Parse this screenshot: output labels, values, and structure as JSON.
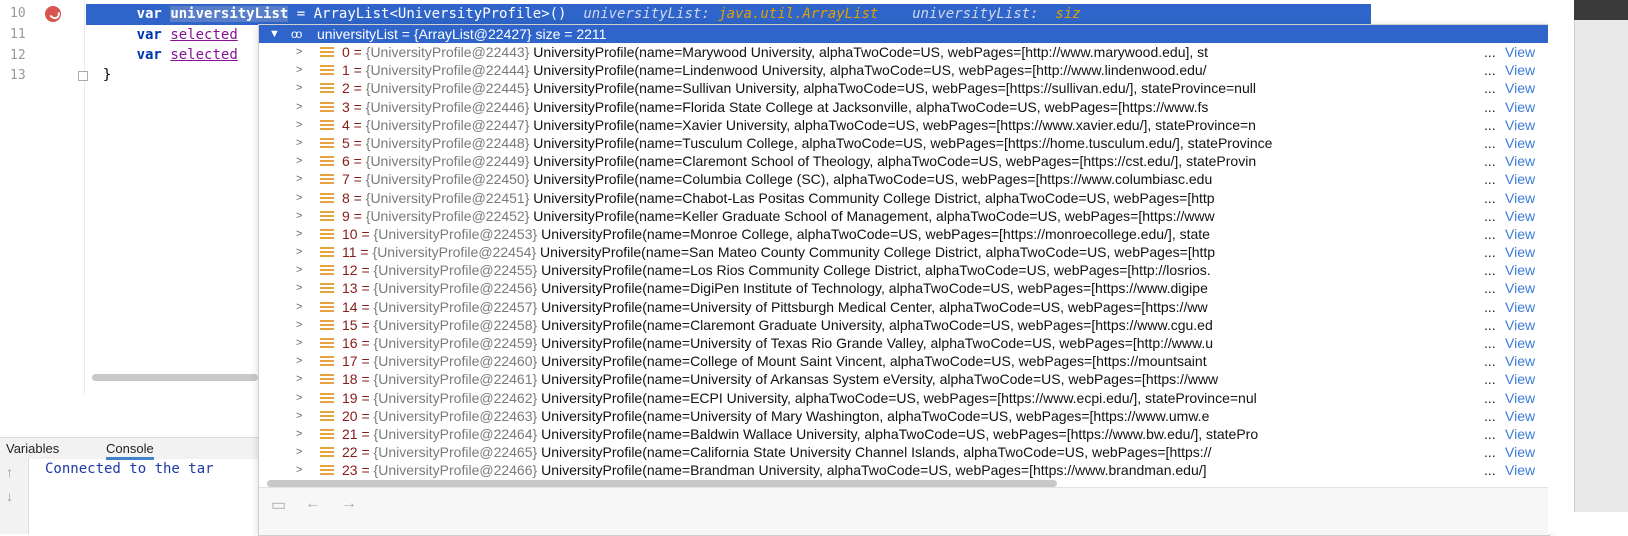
{
  "editor": {
    "line_numbers": [
      "10",
      "11",
      "12",
      "13"
    ],
    "line1": {
      "kw": "var",
      "name": "universityList",
      "rest": " = ArrayList<UniversityProfile>()",
      "hint1_label": "universityList:",
      "hint1_type": "java.util.ArrayList",
      "hint2_label": "universityList:",
      "hint2_type": "siz"
    },
    "line2": {
      "kw": "var",
      "ident": "selected"
    },
    "line3": {
      "kw": "var",
      "ident": "selected"
    },
    "line4": {
      "text": "}"
    }
  },
  "tool_window": {
    "tabs": [
      "Variables",
      "Console"
    ],
    "active_tab": "Console",
    "console_text": "Connected to the tar"
  },
  "popup": {
    "header": "universityList = {ArrayList@22427}  size = 2211",
    "view_label": "View",
    "ellipsis": "...",
    "rows": [
      {
        "idx": "0",
        "ref": "{UniversityProfile@22443}",
        "value": "UniversityProfile(name=Marywood University, alphaTwoCode=US, webPages=[http://www.marywood.edu], st"
      },
      {
        "idx": "1",
        "ref": "{UniversityProfile@22444}",
        "value": "UniversityProfile(name=Lindenwood University, alphaTwoCode=US, webPages=[http://www.lindenwood.edu/"
      },
      {
        "idx": "2",
        "ref": "{UniversityProfile@22445}",
        "value": "UniversityProfile(name=Sullivan University, alphaTwoCode=US, webPages=[https://sullivan.edu/], stateProvince=null"
      },
      {
        "idx": "3",
        "ref": "{UniversityProfile@22446}",
        "value": "UniversityProfile(name=Florida State College at Jacksonville, alphaTwoCode=US, webPages=[https://www.fs"
      },
      {
        "idx": "4",
        "ref": "{UniversityProfile@22447}",
        "value": "UniversityProfile(name=Xavier University, alphaTwoCode=US, webPages=[https://www.xavier.edu/], stateProvince=n"
      },
      {
        "idx": "5",
        "ref": "{UniversityProfile@22448}",
        "value": "UniversityProfile(name=Tusculum College, alphaTwoCode=US, webPages=[https://home.tusculum.edu/], stateProvince"
      },
      {
        "idx": "6",
        "ref": "{UniversityProfile@22449}",
        "value": "UniversityProfile(name=Claremont School of Theology, alphaTwoCode=US, webPages=[https://cst.edu/], stateProvin"
      },
      {
        "idx": "7",
        "ref": "{UniversityProfile@22450}",
        "value": "UniversityProfile(name=Columbia College (SC), alphaTwoCode=US, webPages=[https://www.columbiasc.edu"
      },
      {
        "idx": "8",
        "ref": "{UniversityProfile@22451}",
        "value": "UniversityProfile(name=Chabot-Las Positas Community College District, alphaTwoCode=US, webPages=[http"
      },
      {
        "idx": "9",
        "ref": "{UniversityProfile@22452}",
        "value": "UniversityProfile(name=Keller Graduate School of Management, alphaTwoCode=US, webPages=[https://www"
      },
      {
        "idx": "10",
        "ref": "{UniversityProfile@22453}",
        "value": "UniversityProfile(name=Monroe College, alphaTwoCode=US, webPages=[https://monroecollege.edu/], state"
      },
      {
        "idx": "11",
        "ref": "{UniversityProfile@22454}",
        "value": "UniversityProfile(name=San Mateo County Community College District, alphaTwoCode=US, webPages=[http"
      },
      {
        "idx": "12",
        "ref": "{UniversityProfile@22455}",
        "value": "UniversityProfile(name=Los Rios Community College District, alphaTwoCode=US, webPages=[http://losrios."
      },
      {
        "idx": "13",
        "ref": "{UniversityProfile@22456}",
        "value": "UniversityProfile(name=DigiPen Institute of Technology, alphaTwoCode=US, webPages=[https://www.digipe"
      },
      {
        "idx": "14",
        "ref": "{UniversityProfile@22457}",
        "value": "UniversityProfile(name=University of Pittsburgh Medical Center, alphaTwoCode=US, webPages=[https://ww"
      },
      {
        "idx": "15",
        "ref": "{UniversityProfile@22458}",
        "value": "UniversityProfile(name=Claremont Graduate University, alphaTwoCode=US, webPages=[https://www.cgu.ed"
      },
      {
        "idx": "16",
        "ref": "{UniversityProfile@22459}",
        "value": "UniversityProfile(name=University of Texas Rio Grande Valley, alphaTwoCode=US, webPages=[http://www.u"
      },
      {
        "idx": "17",
        "ref": "{UniversityProfile@22460}",
        "value": "UniversityProfile(name=College of Mount Saint Vincent, alphaTwoCode=US, webPages=[https://mountsaint"
      },
      {
        "idx": "18",
        "ref": "{UniversityProfile@22461}",
        "value": "UniversityProfile(name=University of Arkansas System eVersity, alphaTwoCode=US, webPages=[https://www"
      },
      {
        "idx": "19",
        "ref": "{UniversityProfile@22462}",
        "value": "UniversityProfile(name=ECPI University, alphaTwoCode=US, webPages=[https://www.ecpi.edu/], stateProvince=nul"
      },
      {
        "idx": "20",
        "ref": "{UniversityProfile@22463}",
        "value": "UniversityProfile(name=University of Mary Washington, alphaTwoCode=US, webPages=[https://www.umw.e"
      },
      {
        "idx": "21",
        "ref": "{UniversityProfile@22464}",
        "value": "UniversityProfile(name=Baldwin Wallace University, alphaTwoCode=US, webPages=[https://www.bw.edu/], statePro"
      },
      {
        "idx": "22",
        "ref": "{UniversityProfile@22465}",
        "value": "UniversityProfile(name=California State University Channel Islands, alphaTwoCode=US, webPages=[https://"
      },
      {
        "idx": "23",
        "ref": "{UniversityProfile@22466}",
        "value": "UniversityProfile(name=Brandman University, alphaTwoCode=US, webPages=[https://www.brandman.edu/]"
      }
    ],
    "footer_icons": [
      "restore-icon",
      "back-arrow-icon",
      "forward-arrow-icon"
    ]
  },
  "colors": {
    "selection": "#2f65ca",
    "index": "#871c18",
    "reference": "#7a7a7a",
    "link": "#3b7bd6",
    "hint_type": "#e0a000",
    "breakpoint": "#d9544f",
    "console_text": "#1b38a6"
  }
}
